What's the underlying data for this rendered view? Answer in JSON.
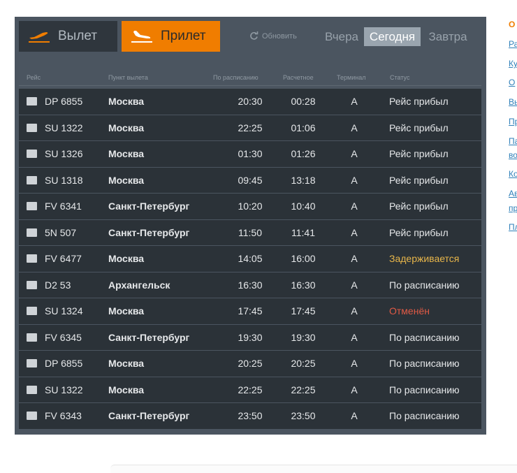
{
  "tabs": {
    "departures": "Вылет",
    "arrivals": "Прилет"
  },
  "refresh_label": "Обновить",
  "days": {
    "yesterday": "Вчера",
    "today": "Сегодня",
    "tomorrow": "Завтра"
  },
  "columns": {
    "flight": "Рейс",
    "origin": "Пункт вылета",
    "scheduled": "По расписанию",
    "estimated": "Расчетное",
    "terminal": "Терминал",
    "status": "Статус"
  },
  "colors": {
    "accent": "#f07d00",
    "delayed": "#e8b64a",
    "cancelled": "#e05a45",
    "normal": "#e6e8ea"
  },
  "flights": [
    {
      "flight": "DP 6855",
      "origin": "Москва",
      "scheduled": "20:30",
      "estimated": "00:28",
      "terminal": "A",
      "status": "Рейс прибыл",
      "status_type": "normal",
      "airline_icon": "pobeda-logo-icon"
    },
    {
      "flight": "SU 1322",
      "origin": "Москва",
      "scheduled": "22:25",
      "estimated": "01:06",
      "terminal": "A",
      "status": "Рейс прибыл",
      "status_type": "normal",
      "airline_icon": "aeroflot-logo-icon"
    },
    {
      "flight": "SU 1326",
      "origin": "Москва",
      "scheduled": "01:30",
      "estimated": "01:26",
      "terminal": "A",
      "status": "Рейс прибыл",
      "status_type": "normal",
      "airline_icon": "aeroflot-logo-icon"
    },
    {
      "flight": "SU 1318",
      "origin": "Москва",
      "scheduled": "09:45",
      "estimated": "13:18",
      "terminal": "A",
      "status": "Рейс прибыл",
      "status_type": "normal",
      "airline_icon": "aeroflot-logo-icon"
    },
    {
      "flight": "FV 6341",
      "origin": "Санкт-Петербург",
      "scheduled": "10:20",
      "estimated": "10:40",
      "terminal": "A",
      "status": "Рейс прибыл",
      "status_type": "normal",
      "airline_icon": "rossiya-logo-icon"
    },
    {
      "flight": "5N 507",
      "origin": "Санкт-Петербург",
      "scheduled": "11:50",
      "estimated": "11:41",
      "terminal": "A",
      "status": "Рейс прибыл",
      "status_type": "normal",
      "airline_icon": "nordavia-logo-icon"
    },
    {
      "flight": "FV 6477",
      "origin": "Москва",
      "scheduled": "14:05",
      "estimated": "16:00",
      "terminal": "A",
      "status": "Задерживается",
      "status_type": "delayed",
      "airline_icon": "rossiya-logo-icon"
    },
    {
      "flight": "D2 53",
      "origin": "Архангельск",
      "scheduled": "16:30",
      "estimated": "16:30",
      "terminal": "A",
      "status": "По расписанию",
      "status_type": "normal",
      "airline_icon": "severstal-logo-icon"
    },
    {
      "flight": "SU 1324",
      "origin": "Москва",
      "scheduled": "17:45",
      "estimated": "17:45",
      "terminal": "A",
      "status": "Отменён",
      "status_type": "cancelled",
      "airline_icon": "aeroflot-logo-icon"
    },
    {
      "flight": "FV 6345",
      "origin": "Санкт-Петербург",
      "scheduled": "19:30",
      "estimated": "19:30",
      "terminal": "A",
      "status": "По расписанию",
      "status_type": "normal",
      "airline_icon": "rossiya-logo-icon"
    },
    {
      "flight": "DP 6855",
      "origin": "Москва",
      "scheduled": "20:25",
      "estimated": "20:25",
      "terminal": "A",
      "status": "По расписанию",
      "status_type": "normal",
      "airline_icon": "pobeda-logo-icon"
    },
    {
      "flight": "SU 1322",
      "origin": "Москва",
      "scheduled": "22:25",
      "estimated": "22:25",
      "terminal": "A",
      "status": "По расписанию",
      "status_type": "normal",
      "airline_icon": "aeroflot-logo-icon"
    },
    {
      "flight": "FV 6343",
      "origin": "Санкт-Петербург",
      "scheduled": "23:50",
      "estimated": "23:50",
      "terminal": "A",
      "status": "По расписанию",
      "status_type": "normal",
      "airline_icon": "rossiya-logo-icon"
    }
  ],
  "sidebar_links": [
    "О",
    "Ра",
    "Ку",
    "О",
    "Вь",
    "Пр",
    "Па",
    "во",
    "Ко",
    "Ав",
    "пр",
    "Пл"
  ]
}
